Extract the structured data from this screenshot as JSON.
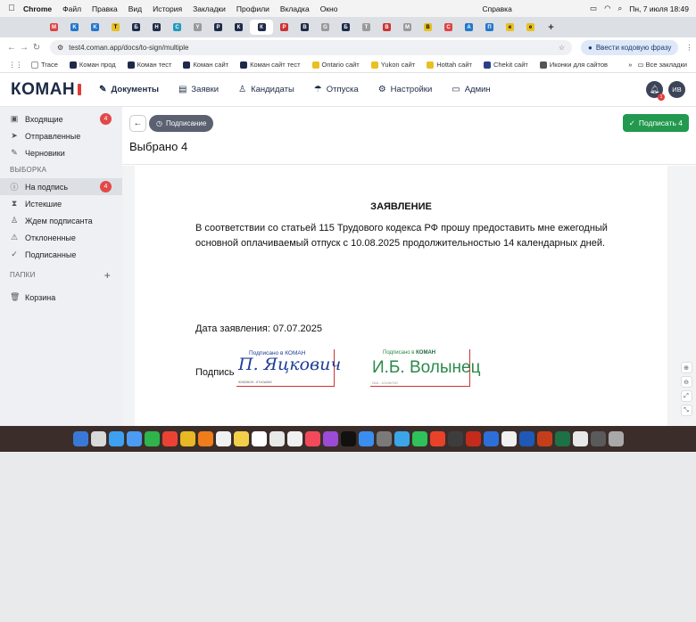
{
  "macbar": {
    "app": "Chrome",
    "menus": [
      "Файл",
      "Правка",
      "Вид",
      "История",
      "Закладки",
      "Профили",
      "Вкладка",
      "Окно",
      "Справка"
    ],
    "time": "Пн, 7 июля  18:49"
  },
  "browser": {
    "url": "test4.coman.app/docs/to-sign/multiple",
    "profile_button": "Ввести кодовую фразу",
    "bookmarks": [
      "Trace",
      "Коман прод",
      "Коман тест",
      "Коман сайт",
      "Коман сайт тест",
      "Ontario сайт",
      "Yukon сайт",
      "Hottah сайт",
      "Chekit сайт",
      "Иконки для сайтов"
    ],
    "all_bookmarks": "Все закладки"
  },
  "app": {
    "logo": "КОМАН",
    "nav": [
      "Документы",
      "Заявки",
      "Кандидаты",
      "Отпуска",
      "Настройки",
      "Админ"
    ],
    "notifications_count": "1",
    "avatar": "ИВ"
  },
  "sidebar": {
    "items": [
      {
        "label": "Входящие",
        "badge": "4"
      },
      {
        "label": "Отправленные"
      },
      {
        "label": "Черновики"
      }
    ],
    "selection_title": "ВЫБОРКА",
    "selection": [
      {
        "label": "На подпись",
        "badge": "4"
      },
      {
        "label": "Истекшие"
      },
      {
        "label": "Ждем подписанта"
      },
      {
        "label": "Отклоненные"
      },
      {
        "label": "Подписанные"
      }
    ],
    "folders_title": "ПАПКИ",
    "trash": "Корзина"
  },
  "main": {
    "status_chip": "Подписание",
    "title": "Выбрано 4",
    "sign_button": "Подписать 4"
  },
  "document": {
    "heading": "ЗАЯВЛЕНИЕ",
    "body": "В соответствии со статьей 115 Трудового кодекса РФ прошу предоставить мне ежегодный основной оплачиваемый отпуск с 10.08.2025 продолжительностью 14 календарных дней.",
    "date": "Дата заявления: 07.07.2025",
    "signature_label": "Подпись",
    "stamp1_top": "Подписано в КОМАН",
    "stamp1_sig": "П. Яцкович",
    "stamp1_hash": "90826b3f...07c0a3d5",
    "stamp2_top": "Подписано в",
    "stamp2_brand": "КОМАН",
    "stamp2_sig": "И.Б. Волынец",
    "stamp2_hash": "f3a1...b2c9e7d0"
  }
}
